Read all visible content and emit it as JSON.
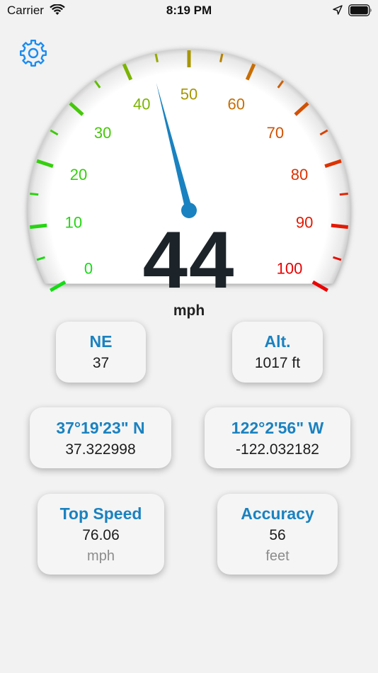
{
  "status_bar": {
    "carrier": "Carrier",
    "time": "8:19 PM"
  },
  "speedometer": {
    "speed": "44",
    "unit": "mph",
    "speed_value": 44,
    "scale_min": 0,
    "scale_max": 100,
    "scale_labels": [
      "0",
      "10",
      "20",
      "30",
      "40",
      "50",
      "60",
      "70",
      "80",
      "90",
      "100"
    ]
  },
  "cards": {
    "heading": {
      "title": "NE",
      "value": "37"
    },
    "altitude": {
      "title": "Alt.",
      "value": "1017 ft"
    },
    "latitude": {
      "title": "37°19'23\" N",
      "value": "37.322998"
    },
    "longitude": {
      "title": "122°2'56\" W",
      "value": "-122.032182"
    },
    "top_speed": {
      "title": "Top Speed",
      "value": "76.06",
      "unit": "mph"
    },
    "accuracy": {
      "title": "Accuracy",
      "value": "56",
      "unit": "feet"
    }
  },
  "colors": {
    "accent": "#1a82c0",
    "needle": "#1a82c0",
    "gear_icon": "#1a8cf0"
  },
  "icons": [
    "wifi-icon",
    "location-arrow-icon",
    "battery-icon",
    "gear-icon"
  ]
}
